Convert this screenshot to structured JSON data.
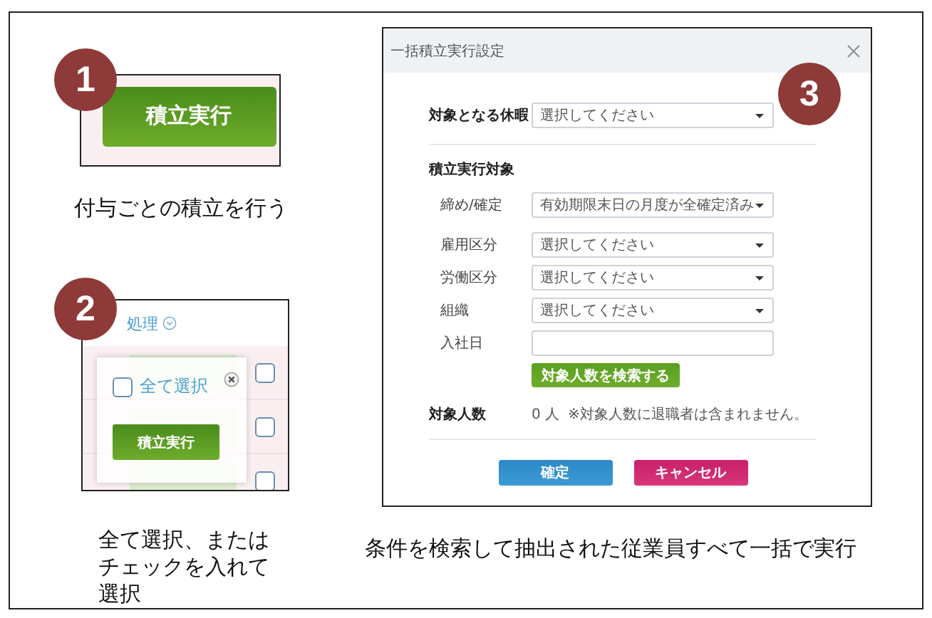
{
  "panel_1": {
    "badge": "1",
    "button": "積立実行",
    "caption": "付与ごとの積立を行う"
  },
  "panel_2": {
    "badge": "2",
    "menu_label": "処理",
    "popup": {
      "select_all": {
        "label": "全て選択",
        "checked": false
      },
      "button": "積立実行"
    },
    "row_checkboxes": [
      {
        "checked": false
      },
      {
        "checked": false
      },
      {
        "checked": false
      }
    ],
    "caption": "全て選択、またはチェックを入れて選択"
  },
  "panel_3": {
    "badge": "3",
    "dialog": {
      "title": "一括積立実行設定",
      "target": {
        "label": "対象となる休暇",
        "value": "選択してください"
      },
      "section": {
        "heading": "積立実行対象",
        "fields": [
          {
            "kind": "select",
            "label": "締め/確定",
            "value": "有効期限末日の月度が全確定済み"
          },
          {
            "kind": "select",
            "label": "雇用区分",
            "value": "選択してください"
          },
          {
            "kind": "select",
            "label": "労働区分",
            "value": "選択してください"
          },
          {
            "kind": "select",
            "label": "組織",
            "value": "選択してください"
          },
          {
            "kind": "input",
            "label": "入社日"
          }
        ]
      },
      "search_button": "対象人数を検索する",
      "count": {
        "label": "対象人数",
        "value": "0 人",
        "note": "※対象人数に退職者は含まれません。"
      },
      "buttons": [
        {
          "kind": "primary",
          "label": "確定"
        },
        {
          "kind": "cancel",
          "label": "キャンセル"
        }
      ]
    },
    "caption": "条件を検索して抽出された従業員すべて一括で実行"
  }
}
